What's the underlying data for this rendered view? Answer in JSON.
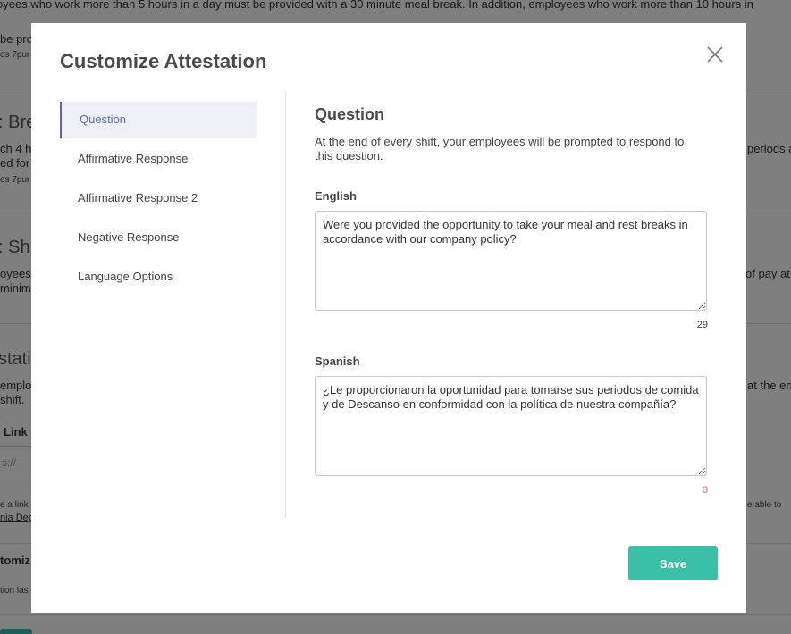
{
  "background": {
    "lines": [
      "oyees who work more than 5 hours in a day must be provided with a 30 minute meal break. In addition, employees who work more than 10 hours in",
      "be pro",
      "es 7pur",
      ": Bre",
      "ch 4 h",
      "periods a",
      "ed for",
      "es 7pur",
      ": Shif",
      "oyees",
      "of pay at",
      "minim",
      "stati",
      "emplo",
      "at the en",
      "shift.",
      "Link",
      "s://",
      "e a link",
      "e able to",
      "nia Dep",
      "tomiz",
      "tion las"
    ]
  },
  "modal": {
    "title": "Customize Attestation",
    "nav": [
      {
        "label": "Question",
        "active": true
      },
      {
        "label": "Affirmative Response",
        "active": false
      },
      {
        "label": "Affirmative Response 2",
        "active": false
      },
      {
        "label": "Negative Response",
        "active": false
      },
      {
        "label": "Language Options",
        "active": false
      }
    ],
    "question": {
      "heading": "Question",
      "description": "At the end of every shift, your employees will be prompted to respond to this question.",
      "english_label": "English",
      "english_value": "Were you provided the opportunity to take your meal and rest breaks in accordance with our company policy?",
      "english_count": "29",
      "spanish_label": "Spanish",
      "spanish_value": "¿Le proporcionaron la oportunidad para tomarse sus periodos de comida y de Descanso en conformidad con la política de nuestra compañía?",
      "spanish_count": "0"
    },
    "save_label": "Save"
  },
  "colors": {
    "accent": "#5a6ab0",
    "save": "#3bbfa6",
    "count_warning": "#e05a5a"
  }
}
